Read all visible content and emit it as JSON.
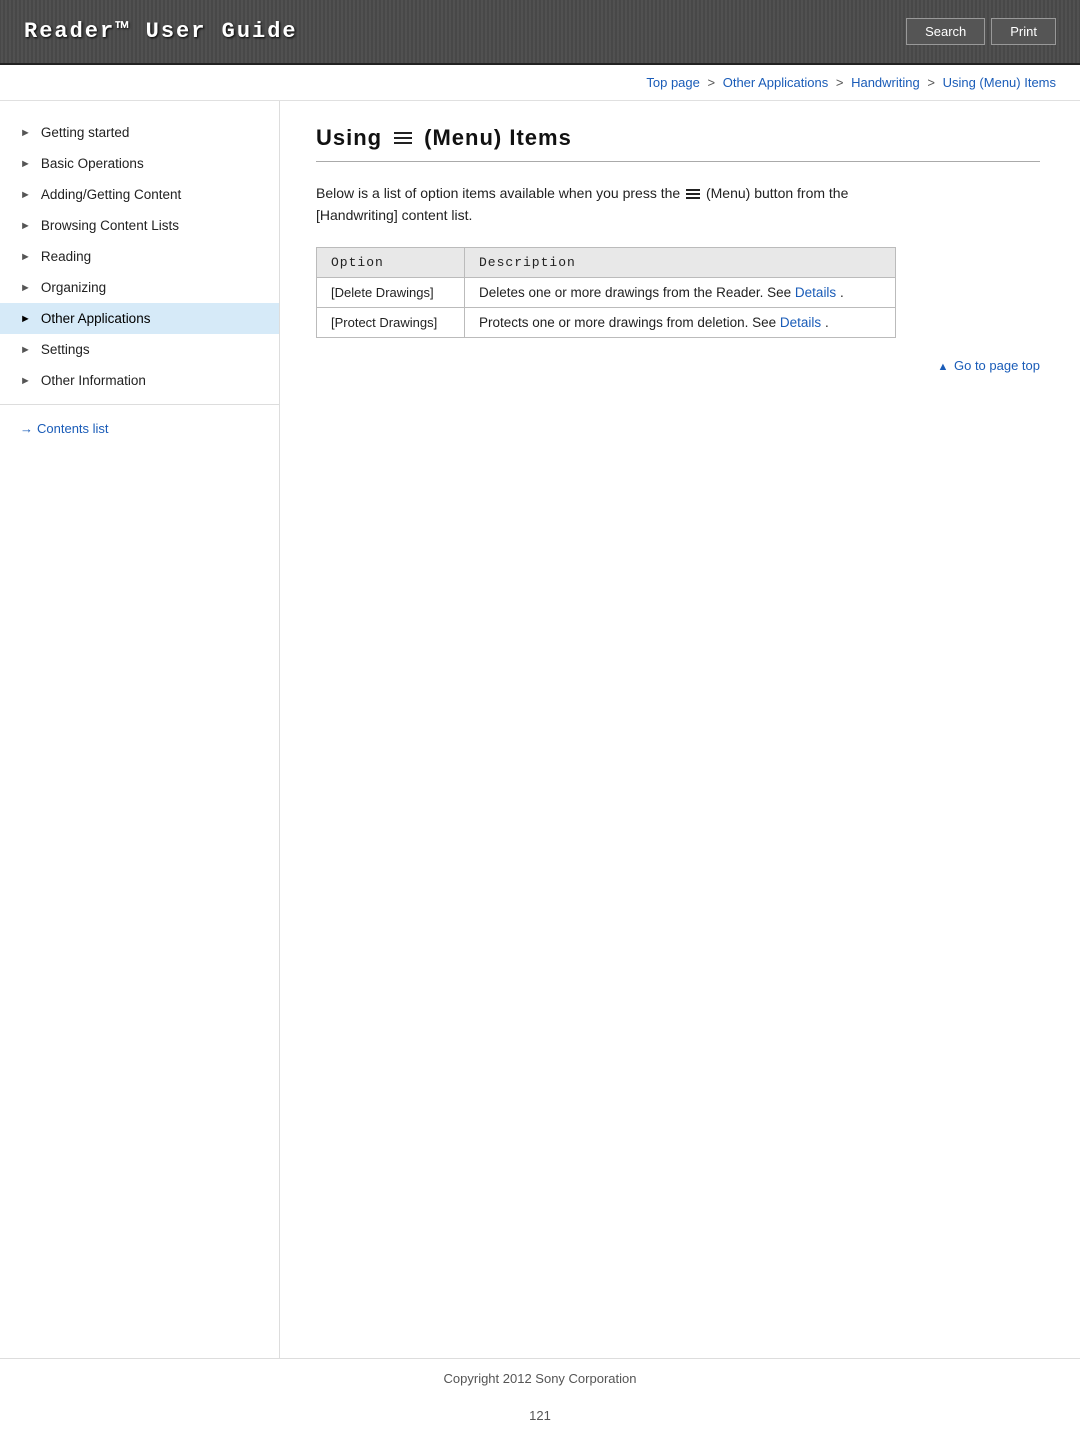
{
  "header": {
    "title": "Reader™ User Guide",
    "search_label": "Search",
    "print_label": "Print"
  },
  "breadcrumb": {
    "top_page": "Top page",
    "sep1": ">",
    "other_apps": "Other Applications",
    "sep2": ">",
    "handwriting": "Handwriting",
    "sep3": ">",
    "current": "Using (Menu) Items"
  },
  "sidebar": {
    "items": [
      {
        "id": "getting-started",
        "label": "Getting started",
        "active": false
      },
      {
        "id": "basic-operations",
        "label": "Basic Operations",
        "active": false
      },
      {
        "id": "adding-getting-content",
        "label": "Adding/Getting Content",
        "active": false
      },
      {
        "id": "browsing-content-lists",
        "label": "Browsing Content Lists",
        "active": false
      },
      {
        "id": "reading",
        "label": "Reading",
        "active": false
      },
      {
        "id": "organizing",
        "label": "Organizing",
        "active": false
      },
      {
        "id": "other-applications",
        "label": "Other Applications",
        "active": true
      },
      {
        "id": "settings",
        "label": "Settings",
        "active": false
      },
      {
        "id": "other-information",
        "label": "Other Information",
        "active": false
      }
    ],
    "contents_link": "Contents list"
  },
  "content": {
    "heading_prefix": "Using",
    "heading_suffix": "(Menu) Items",
    "intro": "Below is a list of option items available when you press the",
    "intro_middle": "(Menu) button from the",
    "intro_suffix": "[Handwriting] content list.",
    "table": {
      "col1_header": "Option",
      "col2_header": "Description",
      "rows": [
        {
          "option": "[Delete Drawings]",
          "description_prefix": "Deletes one or more drawings from the Reader. See ",
          "link_text": "Details",
          "description_suffix": "."
        },
        {
          "option": "[Protect Drawings]",
          "description_prefix": "Protects one or more drawings from deletion. See ",
          "link_text": "Details",
          "description_suffix": "."
        }
      ]
    },
    "go_to_top": "Go to page top"
  },
  "footer": {
    "copyright": "Copyright 2012 Sony Corporation",
    "page_number": "121"
  }
}
